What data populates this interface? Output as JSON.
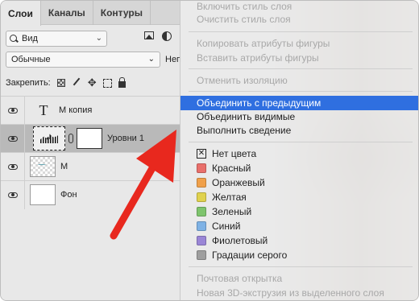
{
  "tabs": [
    {
      "label": "Слои",
      "active": true
    },
    {
      "label": "Каналы",
      "active": false
    },
    {
      "label": "Контуры",
      "active": false
    }
  ],
  "filter": {
    "value": "Вид"
  },
  "blend_mode": {
    "value": "Обычные",
    "opacity_label_cut": "Неп"
  },
  "lock": {
    "label": "Закрепить:"
  },
  "layers": [
    {
      "name": "М копия",
      "type": "text",
      "visible": true,
      "selected": false
    },
    {
      "name": "Уровни 1",
      "type": "adjustment",
      "visible": true,
      "selected": true
    },
    {
      "name": "М",
      "type": "pixel",
      "visible": true,
      "selected": false
    },
    {
      "name": "Фон",
      "type": "background",
      "visible": true,
      "selected": false
    }
  ],
  "menu": {
    "top_cut": [
      "Включить стиль слоя",
      "Очистить стиль слоя"
    ],
    "group1": [
      "Копировать атрибуты фигуры",
      "Вставить атрибуты фигуры"
    ],
    "group2": [
      "Отменить изоляцию"
    ],
    "group3": [
      "Объединить с предыдущим",
      "Объединить видимые",
      "Выполнить сведение"
    ],
    "highlighted": "Объединить с предыдущим",
    "colors": [
      {
        "label": "Нет цвета",
        "color": "none"
      },
      {
        "label": "Красный",
        "color": "#e96f6b"
      },
      {
        "label": "Оранжевый",
        "color": "#f0a04a"
      },
      {
        "label": "Желтая",
        "color": "#e0d24e"
      },
      {
        "label": "Зеленый",
        "color": "#7ec46d"
      },
      {
        "label": "Синий",
        "color": "#7fb2e5"
      },
      {
        "label": "Фиолетовый",
        "color": "#9a86d6"
      },
      {
        "label": "Градации серого",
        "color": "#9e9e9e"
      }
    ],
    "bottom": [
      "Почтовая открытка",
      "Новая 3D-экструзия из выделенного слоя"
    ]
  },
  "colors": {
    "highlight": "#2f6fe0",
    "arrow": "#e8281e"
  }
}
